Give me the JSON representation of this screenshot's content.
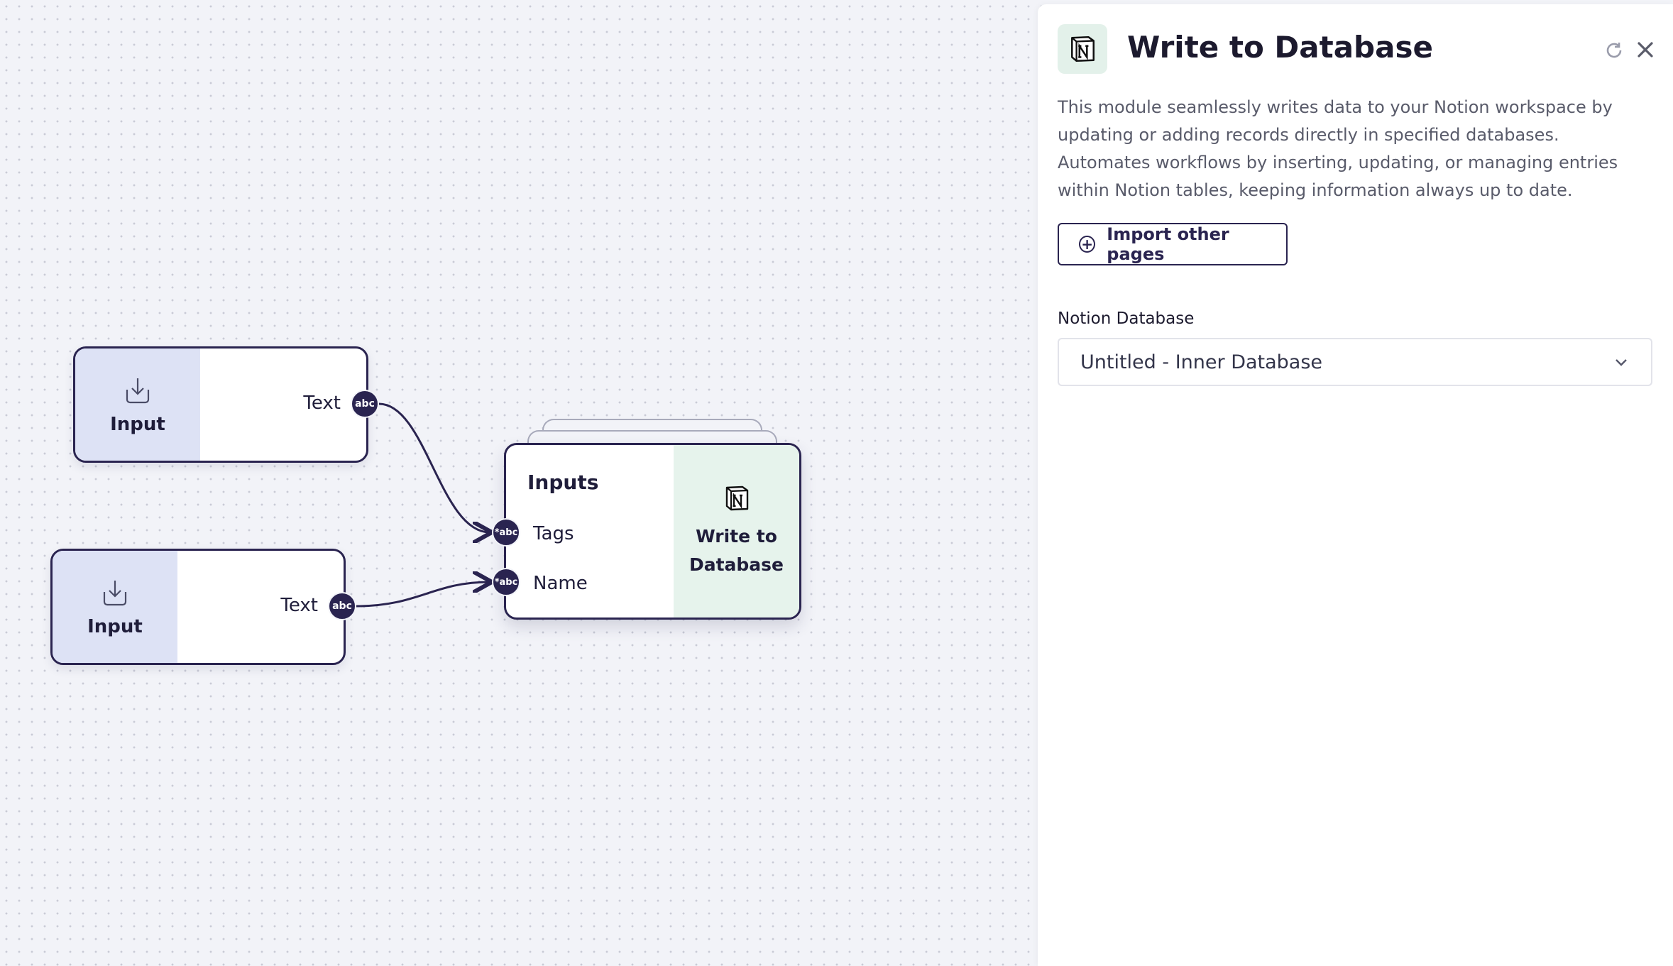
{
  "canvas": {
    "nodes": {
      "input1": {
        "label": "Input",
        "output_label": "Text",
        "port_type": "abc"
      },
      "input2": {
        "label": "Input",
        "output_label": "Text",
        "port_type": "abc"
      },
      "write": {
        "inputs_title": "Inputs",
        "ports": [
          {
            "label": "Tags",
            "port_type": "*abc"
          },
          {
            "label": "Name",
            "port_type": "*abc"
          }
        ],
        "title_line1": "Write to",
        "title_line2": "Database"
      }
    }
  },
  "panel": {
    "title": "Write to Database",
    "description": "This module seamlessly writes data to your Notion workspace by updating or adding records directly in specified databases. Automates workflows by inserting, updating, or managing entries within Notion tables, keeping information always up to date.",
    "import_button": "Import other pages",
    "database_label": "Notion Database",
    "database_selected": "Untitled - Inner Database",
    "icons": [
      "notion-logo-icon",
      "refresh-icon",
      "close-icon",
      "add-circle-icon",
      "chevron-down-icon"
    ]
  },
  "colors": {
    "node_border": "#2a2450",
    "input_node_fill": "#dde2f5",
    "notion_node_fill": "#e6f3ec",
    "canvas_bg": "#f2f3f8"
  }
}
